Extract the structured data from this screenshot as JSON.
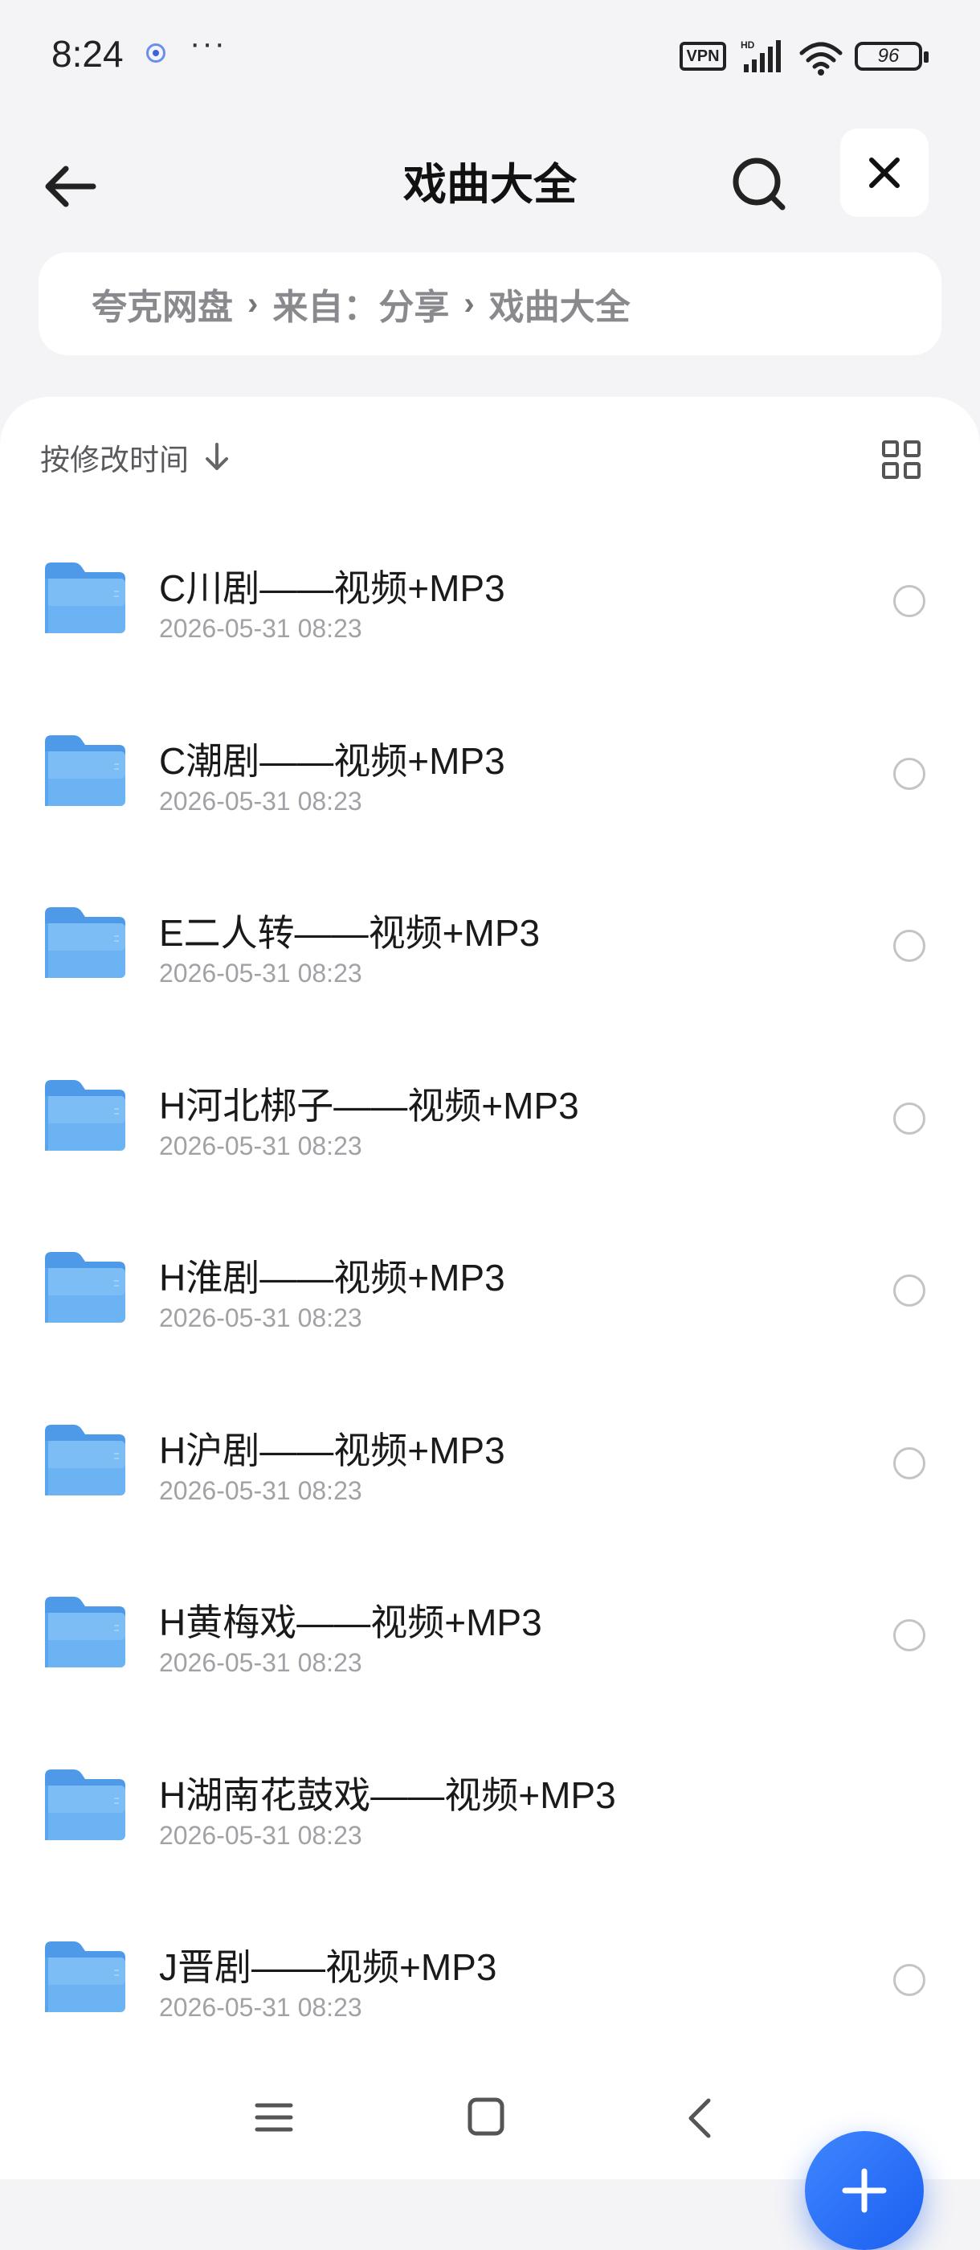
{
  "status_bar": {
    "time": "8:24",
    "more": "···",
    "vpn": "VPN",
    "battery": "96",
    "icons": [
      "app-notification-icon",
      "hd-signal-icon",
      "wifi-icon",
      "battery-icon"
    ]
  },
  "header": {
    "title": "戏曲大全",
    "icons": [
      "back-arrow-icon",
      "search-icon",
      "close-icon"
    ]
  },
  "breadcrumb": [
    "夸克网盘",
    "来自：分享",
    "戏曲大全"
  ],
  "breadcrumb_sep": "›",
  "sort": {
    "label": "按修改时间",
    "icon": "sort-down-arrow-icon"
  },
  "view_toggle_icon": "grid-view-icon",
  "files": [
    {
      "name": "C川剧——视频+MP3",
      "date": "2026-05-31 08:23"
    },
    {
      "name": "C潮剧——视频+MP3",
      "date": "2026-05-31 08:23"
    },
    {
      "name": "E二人转——视频+MP3",
      "date": "2026-05-31 08:23"
    },
    {
      "name": "H河北梆子——视频+MP3",
      "date": "2026-05-31 08:23"
    },
    {
      "name": "H淮剧——视频+MP3",
      "date": "2026-05-31 08:23"
    },
    {
      "name": "H沪剧——视频+MP3",
      "date": "2026-05-31 08:23"
    },
    {
      "name": "H黄梅戏——视频+MP3",
      "date": "2026-05-31 08:23"
    },
    {
      "name": "H湖南花鼓戏——视频+MP3",
      "date": "2026-05-31 08:23"
    },
    {
      "name": "J晋剧——视频+MP3",
      "date": "2026-05-31 08:23"
    }
  ],
  "fab_icon": "plus-icon",
  "colors": {
    "accent": "#2a6ff5",
    "folder": "#5aa6ee",
    "background": "#f4f4f6"
  },
  "nav_icons": [
    "menu-icon",
    "home-icon",
    "back-icon"
  ]
}
